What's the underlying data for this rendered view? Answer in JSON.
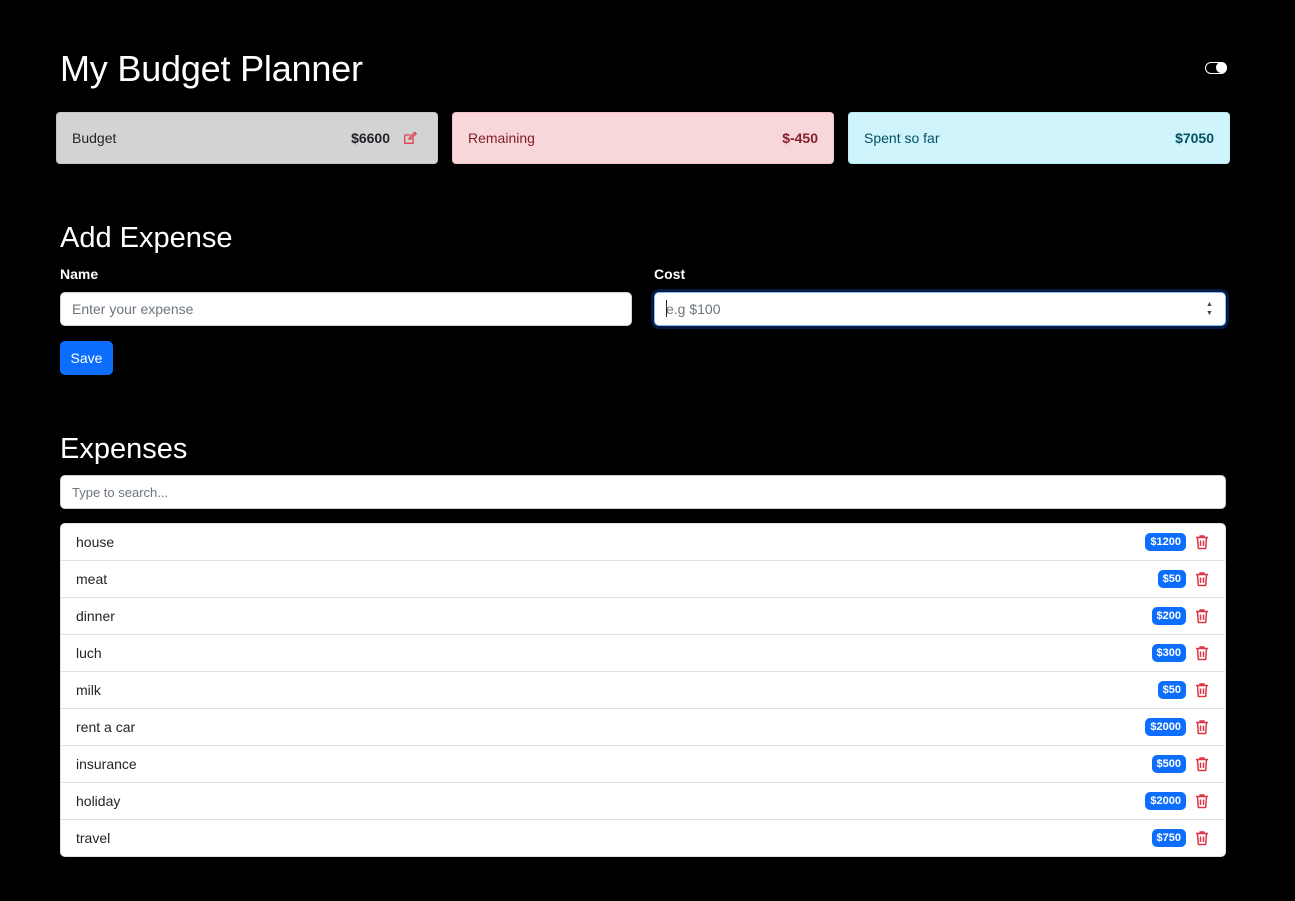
{
  "header": {
    "title": "My Budget Planner",
    "theme_toggle_icon": "toggle-on-icon"
  },
  "summary": {
    "budget": {
      "label": "Budget",
      "value": "$6600",
      "edit_icon": "edit-icon"
    },
    "remaining": {
      "label": "Remaining",
      "value": "$-450"
    },
    "spent": {
      "label": "Spent so far",
      "value": "$7050"
    }
  },
  "add_expense": {
    "heading": "Add Expense",
    "name_label": "Name",
    "name_placeholder": "Enter your expense",
    "cost_label": "Cost",
    "cost_placeholder": "e.g $100",
    "save_label": "Save"
  },
  "expenses": {
    "heading": "Expenses",
    "search_placeholder": "Type to search...",
    "items": [
      {
        "name": "house",
        "cost": "$1200"
      },
      {
        "name": "meat",
        "cost": "$50"
      },
      {
        "name": "dinner",
        "cost": "$200"
      },
      {
        "name": "luch",
        "cost": "$300"
      },
      {
        "name": "milk",
        "cost": "$50"
      },
      {
        "name": "rent a car",
        "cost": "$2000"
      },
      {
        "name": "insurance",
        "cost": "$500"
      },
      {
        "name": "holiday",
        "cost": "$2000"
      },
      {
        "name": "travel",
        "cost": "$750"
      }
    ]
  },
  "colors": {
    "primary": "#0d6efd",
    "danger": "#dc3545",
    "budget_bg": "#d3d3d3",
    "remaining_bg": "#f8d7da",
    "spent_bg": "#cff4fc"
  }
}
